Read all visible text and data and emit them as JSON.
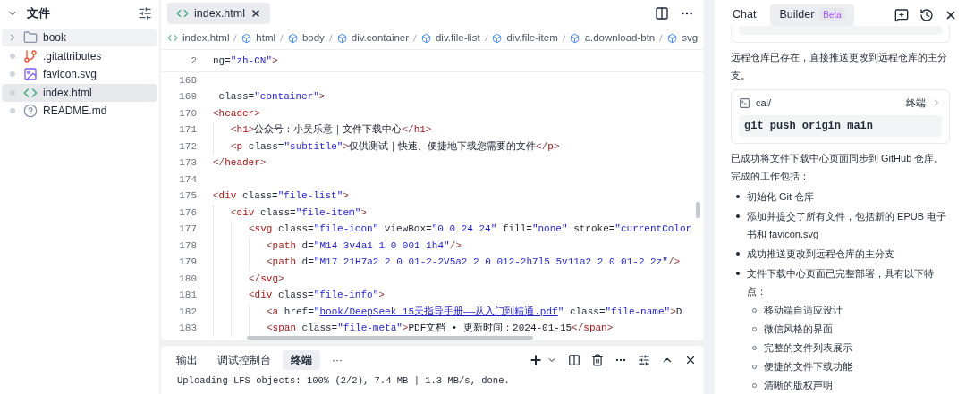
{
  "sidebar": {
    "title": "文件",
    "expanded": true,
    "items": [
      {
        "kind": "folder",
        "name": "book",
        "expanded": false,
        "selected": false,
        "hover": true
      },
      {
        "kind": "git",
        "name": ".gitattributes",
        "selected": false,
        "hover": false
      },
      {
        "kind": "svg",
        "name": "favicon.svg",
        "selected": false,
        "hover": false
      },
      {
        "kind": "html",
        "name": "index.html",
        "selected": true,
        "hover": false
      },
      {
        "kind": "readme",
        "name": "README.md",
        "selected": false,
        "hover": false
      }
    ]
  },
  "editor": {
    "tabs": [
      {
        "label": "index.html",
        "selected": true
      }
    ],
    "breadcrumb": [
      {
        "kind": "file",
        "label": "index.html"
      },
      {
        "kind": "element",
        "label": "html"
      },
      {
        "kind": "element",
        "label": "body"
      },
      {
        "kind": "element",
        "label": "div.container"
      },
      {
        "kind": "element",
        "label": "div.file-list"
      },
      {
        "kind": "element",
        "label": "div.file-item"
      },
      {
        "kind": "element",
        "label": "a.download-btn"
      },
      {
        "kind": "element",
        "label": "svg"
      }
    ],
    "sticky_lines": [
      {
        "number": "2",
        "segments": [
          {
            "kind": "attr",
            "text": "ng="
          },
          {
            "kind": "str",
            "text": "\"zh-CN\""
          },
          {
            "kind": "punct",
            "text": ">"
          }
        ]
      }
    ],
    "lines": [
      {
        "number": "168"
      },
      {
        "number": "169",
        "segments": [
          {
            "kind": "attr",
            "text": " class="
          },
          {
            "kind": "str",
            "text": "\"container\""
          },
          {
            "kind": "punct",
            "text": ">"
          }
        ]
      },
      {
        "number": "170",
        "segments": [
          {
            "kind": "punct",
            "text": "<"
          },
          {
            "kind": "tag",
            "text": "header"
          },
          {
            "kind": "punct",
            "text": ">"
          }
        ],
        "children": [
          {
            "number": "171",
            "segments": [
              {
                "kind": "punct",
                "text": "<"
              },
              {
                "kind": "tag",
                "text": "h1"
              },
              {
                "kind": "punct",
                "text": ">"
              },
              {
                "kind": "text",
                "text": "公众号：小吴乐意｜文件下载中心"
              },
              {
                "kind": "punct",
                "text": "</"
              },
              {
                "kind": "tag",
                "text": "h1"
              },
              {
                "kind": "punct",
                "text": ">"
              }
            ]
          },
          {
            "number": "172",
            "segments": [
              {
                "kind": "punct",
                "text": "<"
              },
              {
                "kind": "tag",
                "text": "p"
              },
              {
                "kind": "attr",
                "text": " class="
              },
              {
                "kind": "str",
                "text": "\"subtitle\""
              },
              {
                "kind": "punct",
                "text": ">"
              },
              {
                "kind": "text",
                "text": "仅供测试｜快速、便捷地下载您需要的文件"
              },
              {
                "kind": "punct",
                "text": "</"
              },
              {
                "kind": "tag",
                "text": "p"
              },
              {
                "kind": "punct",
                "text": ">"
              }
            ]
          }
        ]
      },
      {
        "number": "173",
        "segments": [
          {
            "kind": "punct",
            "text": "</"
          },
          {
            "kind": "tag",
            "text": "header"
          },
          {
            "kind": "punct",
            "text": ">"
          }
        ]
      },
      {
        "number": "174"
      },
      {
        "number": "175",
        "segments": [
          {
            "kind": "punct",
            "text": "<"
          },
          {
            "kind": "tag",
            "text": "div"
          },
          {
            "kind": "attr",
            "text": " class="
          },
          {
            "kind": "str",
            "text": "\"file-list\""
          },
          {
            "kind": "punct",
            "text": ">"
          }
        ],
        "children": [
          {
            "number": "176",
            "segments": [
              {
                "kind": "punct",
                "text": "<"
              },
              {
                "kind": "tag",
                "text": "div"
              },
              {
                "kind": "attr",
                "text": " class="
              },
              {
                "kind": "str",
                "text": "\"file-item\""
              },
              {
                "kind": "punct",
                "text": ">"
              }
            ],
            "children": [
              {
                "number": "177",
                "segments": [
                  {
                    "kind": "punct",
                    "text": "<"
                  },
                  {
                    "kind": "tag",
                    "text": "svg"
                  },
                  {
                    "kind": "attr",
                    "text": " class="
                  },
                  {
                    "kind": "str",
                    "text": "\"file-icon\""
                  },
                  {
                    "kind": "attr",
                    "text": " viewBox="
                  },
                  {
                    "kind": "str",
                    "text": "\"0 0 24 24\""
                  },
                  {
                    "kind": "attr",
                    "text": " fill="
                  },
                  {
                    "kind": "str",
                    "text": "\"none\""
                  },
                  {
                    "kind": "attr",
                    "text": " stroke="
                  },
                  {
                    "kind": "str",
                    "text": "\"currentColor"
                  }
                ],
                "children": [
                  {
                    "number": "178",
                    "segments": [
                      {
                        "kind": "punct",
                        "text": "<"
                      },
                      {
                        "kind": "tag",
                        "text": "path"
                      },
                      {
                        "kind": "attr",
                        "text": " d="
                      },
                      {
                        "kind": "str",
                        "text": "\"M14 3v4a1 1 0 001 1h4\""
                      },
                      {
                        "kind": "punct",
                        "text": "/>"
                      }
                    ]
                  },
                  {
                    "number": "179",
                    "segments": [
                      {
                        "kind": "punct",
                        "text": "<"
                      },
                      {
                        "kind": "tag",
                        "text": "path"
                      },
                      {
                        "kind": "attr",
                        "text": " d="
                      },
                      {
                        "kind": "str",
                        "text": "\"M17 21H7a2 2 0 01-2-2V5a2 2 0 012-2h7l5 5v11a2 2 0 01-2 2z\""
                      },
                      {
                        "kind": "punct",
                        "text": "/>"
                      }
                    ]
                  }
                ]
              },
              {
                "number": "180",
                "segments": [
                  {
                    "kind": "punct",
                    "text": "</"
                  },
                  {
                    "kind": "tag",
                    "text": "svg"
                  },
                  {
                    "kind": "punct",
                    "text": ">"
                  }
                ]
              },
              {
                "number": "181",
                "segments": [
                  {
                    "kind": "punct",
                    "text": "<"
                  },
                  {
                    "kind": "tag",
                    "text": "div"
                  },
                  {
                    "kind": "attr",
                    "text": " class="
                  },
                  {
                    "kind": "str",
                    "text": "\"file-info\""
                  },
                  {
                    "kind": "punct",
                    "text": ">"
                  }
                ],
                "children": [
                  {
                    "number": "182",
                    "segments": [
                      {
                        "kind": "punct",
                        "text": "<"
                      },
                      {
                        "kind": "tag",
                        "text": "a"
                      },
                      {
                        "kind": "attr",
                        "text": " href="
                      },
                      {
                        "kind": "str",
                        "text": "\""
                      },
                      {
                        "kind": "link",
                        "text": "book/DeepSeek 15天指导手册——从入门到精通.pdf"
                      },
                      {
                        "kind": "str",
                        "text": "\""
                      },
                      {
                        "kind": "attr",
                        "text": " class="
                      },
                      {
                        "kind": "str",
                        "text": "\"file-name\""
                      },
                      {
                        "kind": "punct",
                        "text": ">"
                      },
                      {
                        "kind": "text",
                        "text": "D"
                      }
                    ]
                  },
                  {
                    "number": "183",
                    "segments": [
                      {
                        "kind": "punct",
                        "text": "<"
                      },
                      {
                        "kind": "tag",
                        "text": "span"
                      },
                      {
                        "kind": "attr",
                        "text": " class="
                      },
                      {
                        "kind": "str",
                        "text": "\"file-meta\""
                      },
                      {
                        "kind": "punct",
                        "text": ">"
                      },
                      {
                        "kind": "text",
                        "text": "PDF文档 • 更新时间：2024-01-15"
                      },
                      {
                        "kind": "punct",
                        "text": "</"
                      },
                      {
                        "kind": "tag",
                        "text": "span"
                      },
                      {
                        "kind": "punct",
                        "text": ">"
                      }
                    ]
                  }
                ]
              }
            ]
          }
        ]
      }
    ]
  },
  "panel": {
    "tabs": [
      {
        "label": "输出",
        "selected": false
      },
      {
        "label": "调试控制台",
        "selected": false
      },
      {
        "label": "终端",
        "selected": true
      },
      {
        "label": "···",
        "selected": false
      }
    ],
    "output": [
      "Uploading LFS objects: 100% (2/2), 7.4 MB | 1.3 MB/s, done."
    ]
  },
  "assistant": {
    "tabs": [
      {
        "label": "Chat",
        "selected": false
      },
      {
        "label": "Builder",
        "selected": true,
        "badge": "Beta"
      }
    ],
    "messages": [
      {
        "kind": "paragraph",
        "text": "远程仓库已存在，直接推送更改到远程仓库的主分支。"
      },
      {
        "kind": "command",
        "path": "cal/",
        "target": "终端",
        "command": "git push origin main"
      },
      {
        "kind": "paragraph",
        "text": "已成功将文件下载中心页面同步到 GitHub 仓库。完成的工作包括："
      },
      {
        "kind": "list",
        "items": [
          {
            "text": "初始化 Git 仓库"
          },
          {
            "text": "添加并提交了所有文件，包括新的 EPUB 电子书和 favicon.svg"
          },
          {
            "text": "成功推送更改到远程仓库的主分支"
          },
          {
            "text": "文件下载中心页面已完整部署，具有以下特点：",
            "children": [
              {
                "text": "移动端自适应设计"
              },
              {
                "text": "微信风格的界面"
              },
              {
                "text": "完整的文件列表展示"
              },
              {
                "text": "便捷的文件下载功能"
              },
              {
                "text": "清晰的版权声明"
              }
            ]
          }
        ]
      }
    ]
  }
}
